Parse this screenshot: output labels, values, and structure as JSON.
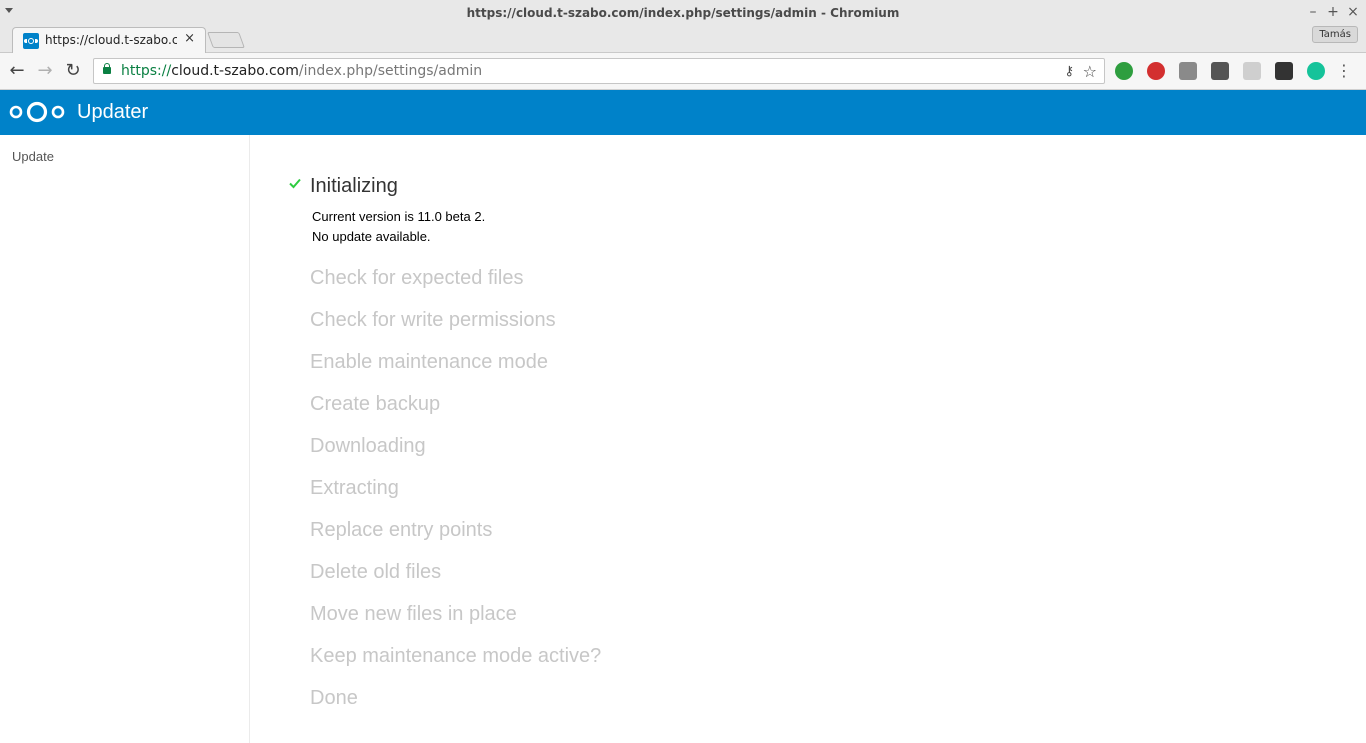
{
  "window": {
    "title": "https://cloud.t-szabo.com/index.php/settings/admin - Chromium",
    "minimize": "–",
    "maximize": "+",
    "close": "×"
  },
  "tabs": [
    {
      "label": "https://cloud.t-szabo.com/index.php/settings/admin",
      "close": "×"
    }
  ],
  "profile": {
    "name": "Tamás"
  },
  "toolbar": {
    "back": "←",
    "forward": "→",
    "reload": "↻",
    "url_scheme": "https://",
    "url_host": "cloud.t-szabo.com",
    "url_path": "/index.php/settings/admin",
    "key_icon": "⚷",
    "star_icon": "☆",
    "menu": "⋮"
  },
  "extensions": [
    {
      "name": "extension-green-icon",
      "color": "#2e9e3f"
    },
    {
      "name": "extension-opera-icon",
      "color": "#d32f2f"
    },
    {
      "name": "extension-gray-icon",
      "color": "#8a8a8a"
    },
    {
      "name": "extension-bulb-icon",
      "color": "#555555"
    },
    {
      "name": "extension-image-icon",
      "color": "#cfcfcf"
    },
    {
      "name": "extension-glasses-icon",
      "color": "#333333"
    },
    {
      "name": "extension-grammarly-icon",
      "color": "#15c39a"
    }
  ],
  "app": {
    "title": "Updater",
    "brand_color": "#0082c9"
  },
  "sidebar": {
    "items": [
      {
        "label": "Update"
      }
    ]
  },
  "updater": {
    "steps": [
      {
        "label": "Initializing",
        "status": "done"
      },
      {
        "label": "Check for expected files",
        "status": "pending"
      },
      {
        "label": "Check for write permissions",
        "status": "pending"
      },
      {
        "label": "Enable maintenance mode",
        "status": "pending"
      },
      {
        "label": "Create backup",
        "status": "pending"
      },
      {
        "label": "Downloading",
        "status": "pending"
      },
      {
        "label": "Extracting",
        "status": "pending"
      },
      {
        "label": "Replace entry points",
        "status": "pending"
      },
      {
        "label": "Delete old files",
        "status": "pending"
      },
      {
        "label": "Move new files in place",
        "status": "pending"
      },
      {
        "label": "Keep maintenance mode active?",
        "status": "pending"
      },
      {
        "label": "Done",
        "status": "pending"
      }
    ],
    "details": [
      "Current version is 11.0 beta 2.",
      "No update available."
    ],
    "done_color": "#2ecc40"
  }
}
